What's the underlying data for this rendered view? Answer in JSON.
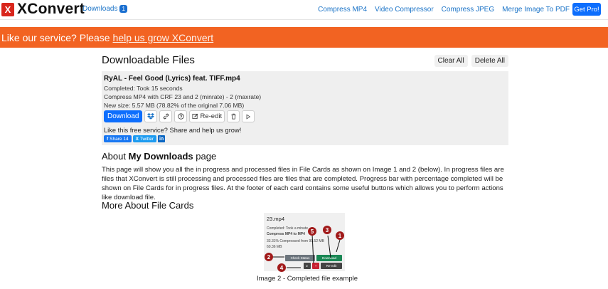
{
  "navbar": {
    "logo_mark": "X",
    "logo_text": "XConvert",
    "downloads_label": "Downloads",
    "downloads_count": "1",
    "links": [
      "Compress MP4",
      "Video Compressor",
      "Compress JPEG",
      "Merge Image To PDF"
    ],
    "get_pro": "Get Pro!"
  },
  "banner": {
    "text": "Like our service? Please",
    "link": "help us grow XConvert"
  },
  "main": {
    "title": "Downloadable Files",
    "clear_all": "Clear All",
    "delete_all": "Delete All"
  },
  "file_card": {
    "title": "RyAL - Feel Good (Lyrics) feat. TIFF.mp4",
    "completed": "Completed: Took 15 seconds",
    "compress_info": "Compress MP4 with CRF 23 and 2 (minrate) - 2 (maxrate)",
    "new_size": "New size: 5.57 MB (78.82% of the original 7.06 MB)",
    "download_label": "Download",
    "reedit_label": "Re-edit",
    "share_text": "Like this free service? Share and help us grow!",
    "share_fb": "Share 14",
    "share_x": "Twitter",
    "share_li": "in"
  },
  "about": {
    "title_prefix": "About",
    "title_bold": "My Downloads",
    "title_suffix": "page",
    "text": "This page will show you all the in progress and processed files in File Cards as shown on Image 1 and 2 (below). In progress files are files that XConvert is still processing and processed files are files that are completed. Progress bar with percentage completed will be shown on File Cards for in progress files. At the footer of each card contains some useful buttons which allows you to perform actions like download file."
  },
  "more": {
    "title": "More About File Cards"
  },
  "example": {
    "title": "23.mp4",
    "completed": "Completed: Took a minute",
    "compress": "Compress MP4 to MP4",
    "progress": "33.31% Compressed from 90.52 MB",
    "size": "60.36 MB",
    "check_status": "Check Status",
    "download": "Download",
    "reedit": "Re-edit",
    "markers": [
      "1",
      "2",
      "3",
      "4",
      "5"
    ],
    "caption": "Image 2 - Completed file example"
  },
  "colors": {
    "banner": "#f26322",
    "primary": "#0d6efd",
    "logo": "#d9261c"
  }
}
